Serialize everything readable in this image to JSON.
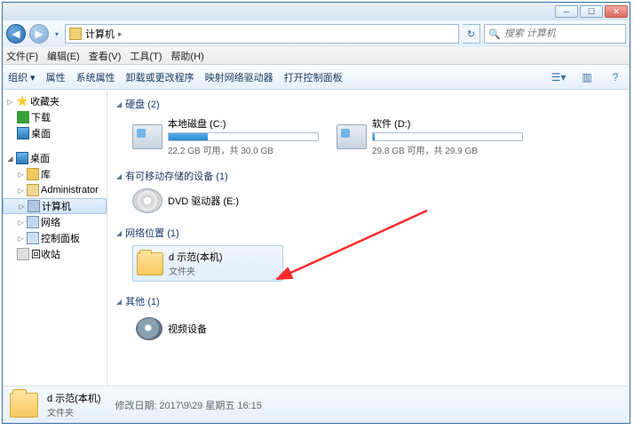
{
  "titlebar": {
    "min": "─",
    "max": "☐",
    "close": "✕"
  },
  "nav": {
    "location_label": "计算机",
    "crumb_sep": "▸",
    "refresh": "↻",
    "search_placeholder": "搜索 计算机"
  },
  "menubar": [
    "文件(F)",
    "编辑(E)",
    "查看(V)",
    "工具(T)",
    "帮助(H)"
  ],
  "toolbar": {
    "items": [
      "组织 ▾",
      "属性",
      "系统属性",
      "卸载或更改程序",
      "映射网络驱动器",
      "打开控制面板"
    ]
  },
  "sidebar": {
    "fav": "收藏夹",
    "dl": "下载",
    "desk": "桌面",
    "desk2": "桌面",
    "lib": "库",
    "user": "Administrator",
    "comp": "计算机",
    "net": "网络",
    "cp": "控制面板",
    "bin": "回收站"
  },
  "groups": {
    "hdd": {
      "title": "硬盘 (2)"
    },
    "removable": {
      "title": "有可移动存储的设备 (1)"
    },
    "netloc": {
      "title": "网络位置 (1)"
    },
    "other": {
      "title": "其他 (1)"
    }
  },
  "drives": [
    {
      "name": "本地磁盘 (C:)",
      "sub": "22.2 GB 可用，共 30.0 GB",
      "fill": 26
    },
    {
      "name": "软件 (D:)",
      "sub": "29.8 GB 可用，共 29.9 GB",
      "fill": 1
    }
  ],
  "dvd": {
    "name": "DVD 驱动器 (E:)"
  },
  "netfolder": {
    "name": "d 示范(本机)",
    "sub": "文件夹"
  },
  "other_item": {
    "name": "视频设备"
  },
  "details": {
    "name": "d 示范(本机)",
    "type": "文件夹",
    "mod_label": "修改日期:",
    "mod_value": "2017\\9\\29 星期五 16:15"
  }
}
